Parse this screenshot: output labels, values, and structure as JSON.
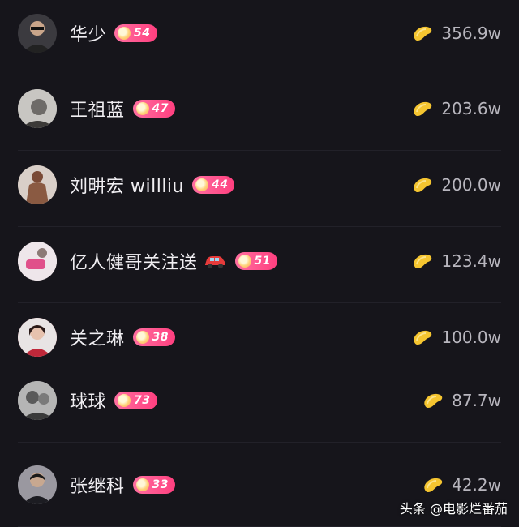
{
  "list": [
    {
      "name": "华少",
      "level": "54",
      "amount": "356.9w",
      "avatar_color": "#3b3a3f"
    },
    {
      "name": "王祖蓝",
      "level": "47",
      "amount": "203.6w",
      "avatar_color": "#8e8c8a"
    },
    {
      "name": "刘畊宏 willliu",
      "level": "44",
      "amount": "200.0w",
      "avatar_color": "#a08c82"
    },
    {
      "name": "亿人健哥关注送",
      "level": "51",
      "amount": "123.4w",
      "avatar_color": "#d8c4cc",
      "has_car": true
    },
    {
      "name": "关之琳",
      "level": "38",
      "amount": "100.0w",
      "avatar_color": "#b03a48"
    },
    {
      "name": "球球",
      "level": "73",
      "amount": "87.7w",
      "avatar_color": "#8a8a8a"
    },
    {
      "name": "张继科",
      "level": "33",
      "amount": "42.2w",
      "avatar_color": "#4a4850"
    }
  ],
  "icons": {
    "badge": "level-badge-icon",
    "coin": "gold-bean-icon",
    "car": "red-car-icon"
  },
  "colors": {
    "background": "#16151b",
    "badge": "#ff4f8b",
    "bean": "#f5c530"
  },
  "watermark": "头条 @电影烂番茄"
}
